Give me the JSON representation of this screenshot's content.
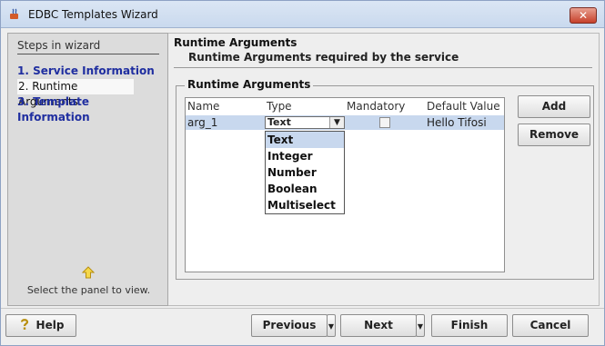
{
  "window": {
    "title": "EDBC Templates Wizard"
  },
  "steps": {
    "title": "Steps in wizard",
    "items": [
      {
        "label": "1. Service Information",
        "active": false
      },
      {
        "label": "2. Runtime Arguments",
        "active": true
      },
      {
        "label": "3. Template Information",
        "active": false
      }
    ],
    "hint": "Select the panel to view."
  },
  "page": {
    "title": "Runtime Arguments",
    "subtitle": "Runtime Arguments required by the service"
  },
  "group": {
    "legend": "Runtime Arguments",
    "columns": [
      "Name",
      "Type",
      "Mandatory",
      "Default Value"
    ],
    "rows": [
      {
        "name": "arg_1",
        "type": "Text",
        "mandatory": false,
        "default": "Hello Tifosi"
      }
    ],
    "dropdown_options": [
      "Text",
      "Integer",
      "Number",
      "Boolean",
      "Multiselect"
    ],
    "add_label": "Add",
    "remove_label": "Remove"
  },
  "footer": {
    "help_label": "Help",
    "previous_label": "Previous",
    "next_label": "Next",
    "finish_label": "Finish",
    "cancel_label": "Cancel"
  },
  "colors": {
    "step_link": "#1f2ea0",
    "selection": "#c8d8ee",
    "close_button": "#c6402a"
  }
}
